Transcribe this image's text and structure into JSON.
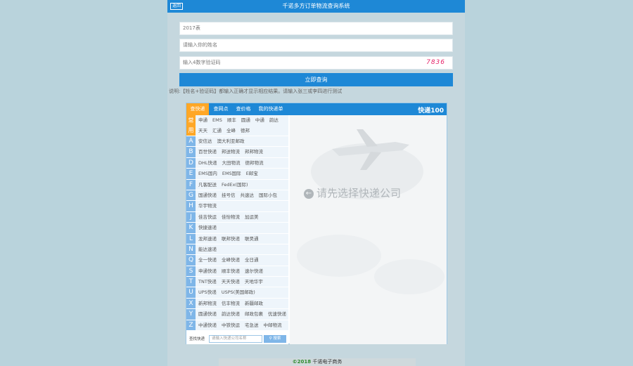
{
  "header": {
    "back_label": "返回",
    "title": "千诺多方订单物流查询系统"
  },
  "form": {
    "year_value": "2017表",
    "name_placeholder": "请输入你的姓名",
    "code_placeholder": "输入4数字验证码",
    "captcha": "7836",
    "submit_label": "立即查询"
  },
  "tip": "说明:【姓名+验证码】都输入正确才显示相应结果。请输入张三或李四进行测试",
  "widget": {
    "tabs": [
      "查快递",
      "查网点",
      "查价格",
      "我的快递单"
    ],
    "logo": "快递100",
    "rows": [
      {
        "letter": "常用",
        "names": [
          "申通",
          "EMS",
          "顺丰",
          "圆通",
          "中通",
          "韵达",
          "天天",
          "汇通",
          "全峰",
          "德邦"
        ]
      },
      {
        "letter": "A",
        "names": [
          "安信达",
          "澳大利亚邮政"
        ]
      },
      {
        "letter": "B",
        "names": [
          "百世快递",
          "邦送物流",
          "邦邦物流"
        ]
      },
      {
        "letter": "D",
        "names": [
          "DHL快递",
          "大田物流",
          "德邦物流"
        ]
      },
      {
        "letter": "E",
        "names": [
          "EMS国内",
          "EMS国际",
          "E邮宝"
        ]
      },
      {
        "letter": "F",
        "names": [
          "凡客配送",
          "FedEx(国际)"
        ]
      },
      {
        "letter": "G",
        "names": [
          "国通快递",
          "挂号信",
          "共速达",
          "国际小包"
        ]
      },
      {
        "letter": "H",
        "names": [
          "华宇物流"
        ]
      },
      {
        "letter": "J",
        "names": [
          "佳吉快运",
          "佳怡物流",
          "加运美"
        ]
      },
      {
        "letter": "K",
        "names": [
          "快捷速递"
        ]
      },
      {
        "letter": "L",
        "names": [
          "龙邦速递",
          "联邦快递",
          "联昊通"
        ]
      },
      {
        "letter": "N",
        "names": [
          "能达速递"
        ]
      },
      {
        "letter": "Q",
        "names": [
          "全一快递",
          "全峰快递",
          "全日通"
        ]
      },
      {
        "letter": "S",
        "names": [
          "申通快递",
          "顺丰快递",
          "速尔快递"
        ]
      },
      {
        "letter": "T",
        "names": [
          "TNT快递",
          "天天快递",
          "天地华宇"
        ]
      },
      {
        "letter": "U",
        "names": [
          "UPS快递",
          "USPS(美国邮政)"
        ]
      },
      {
        "letter": "X",
        "names": [
          "新邦物流",
          "信丰物流",
          "新疆邮政"
        ]
      },
      {
        "letter": "Y",
        "names": [
          "圆通快递",
          "韵达快递",
          "邮政包裹",
          "优速快递"
        ]
      },
      {
        "letter": "Z",
        "names": [
          "中通快递",
          "中铁快运",
          "宅急送",
          "中邮物流"
        ]
      }
    ],
    "search_label": "查找快递",
    "search_placeholder": "请输入快递公司名称",
    "search_button": "搜索",
    "hint": "请先选择快递公司"
  },
  "footer": {
    "copyright": "©2018",
    "company": "千诺电子商务"
  },
  "colors": {
    "primary": "#1e88d6",
    "accent": "#ffa726",
    "captcha": "#e6256a"
  }
}
